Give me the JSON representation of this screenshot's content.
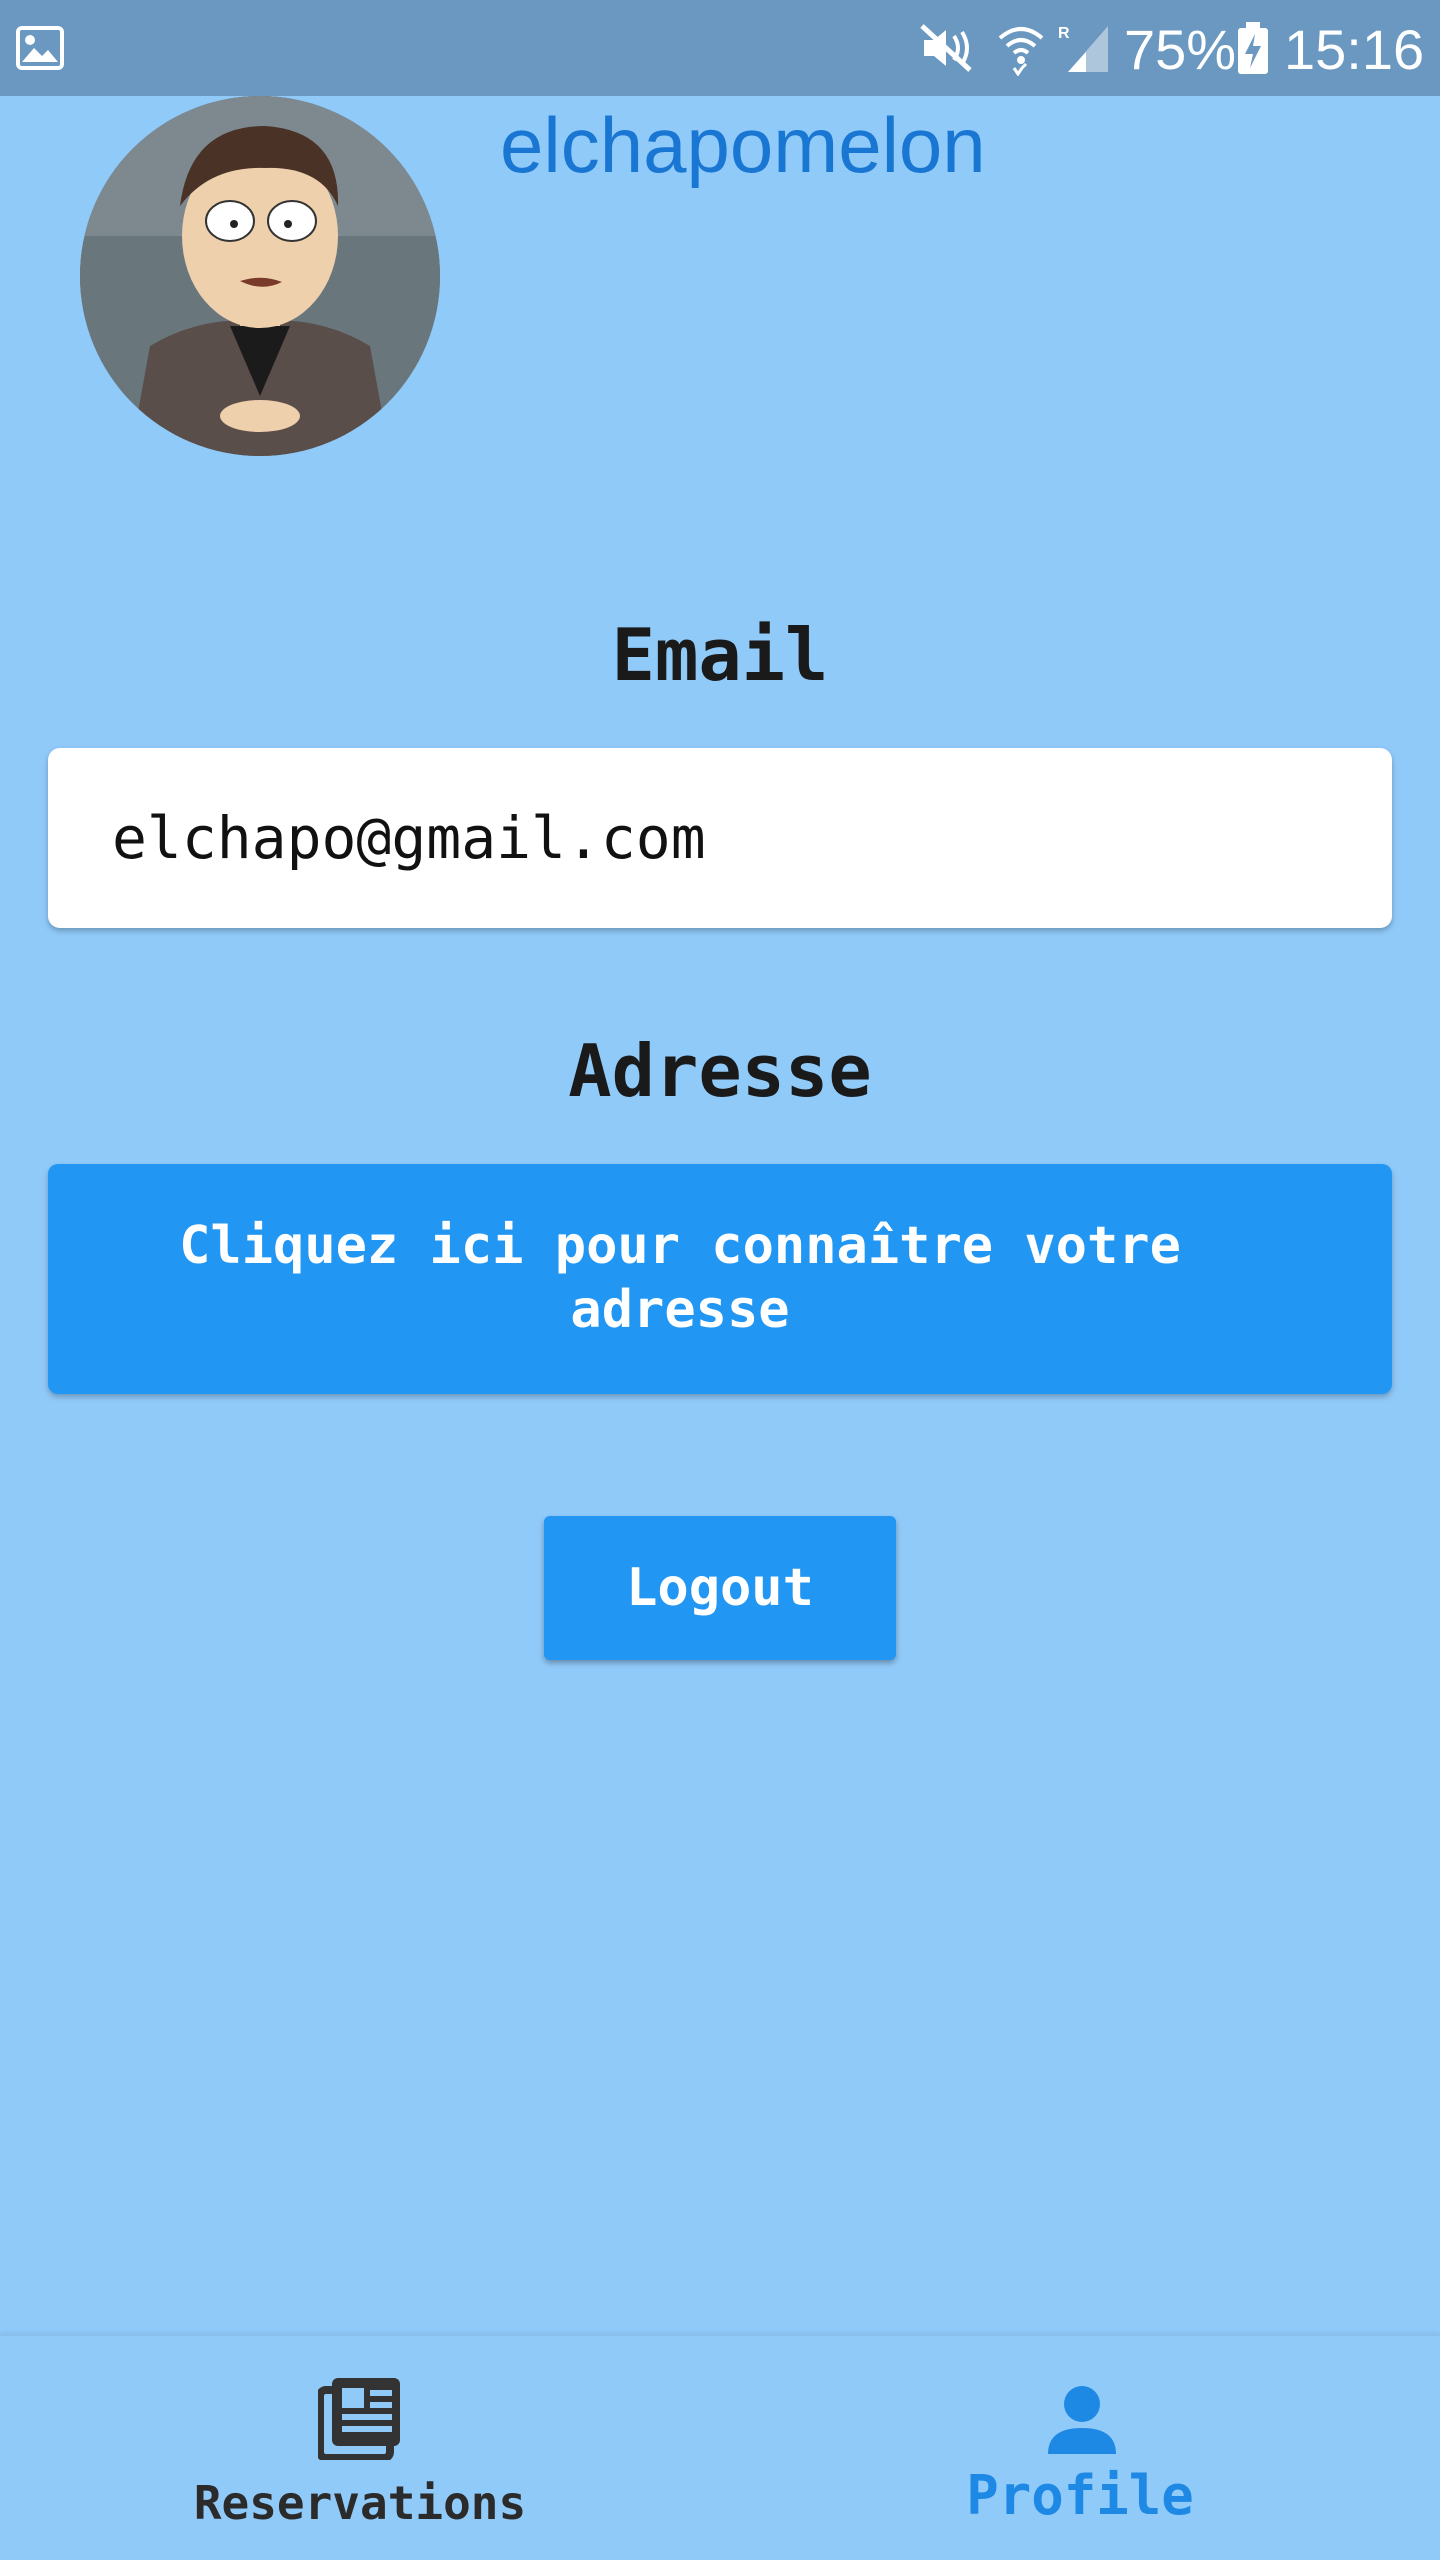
{
  "status_bar": {
    "battery_percent": "75%",
    "time": "15:16",
    "icons": [
      "gallery-icon",
      "mute-icon",
      "wifi-icon",
      "signal-icon",
      "battery-charging-icon"
    ]
  },
  "profile": {
    "username": "elchapomelon",
    "avatar": "avatar-icon"
  },
  "email": {
    "label": "Email",
    "value": "elchapo@gmail.com"
  },
  "address": {
    "label": "Adresse",
    "button_label": "Cliquez ici pour connaître votre adresse"
  },
  "logout": {
    "label": "Logout"
  },
  "bottom_nav": {
    "items": [
      {
        "label": "Reservations",
        "icon": "newspaper-icon",
        "active": false
      },
      {
        "label": "Profile",
        "icon": "person-icon",
        "active": true
      }
    ]
  },
  "colors": {
    "background": "#90caf9",
    "status_bar": "#6a98c0",
    "primary": "#2196f3",
    "username": "#1976d2",
    "active_nav": "#1e88e5"
  }
}
